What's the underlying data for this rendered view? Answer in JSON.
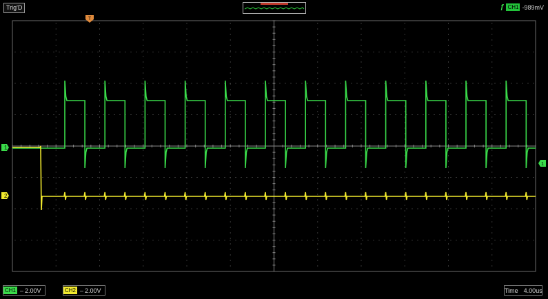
{
  "header": {
    "trigger_mode": "Trig'D",
    "trigger_source": "CH1",
    "trigger_level": "-989mV",
    "trigger_slope_icon": "rising-edge-icon",
    "trigger_position_marker": "T"
  },
  "channels": [
    {
      "id": "CH1",
      "marker": "1",
      "scale": "2.00V",
      "coupling": "DC",
      "color": "#3adb4a"
    },
    {
      "id": "CH2",
      "marker": "2",
      "scale": "2.00V",
      "coupling": "DC",
      "color": "#f2ea2e"
    }
  ],
  "timebase": {
    "label": "Time",
    "value": "4.00us"
  },
  "colors": {
    "grid": "#6b6b6b",
    "background": "#000000",
    "ch1": "#3adb4a",
    "ch2": "#f2ea2e"
  }
}
